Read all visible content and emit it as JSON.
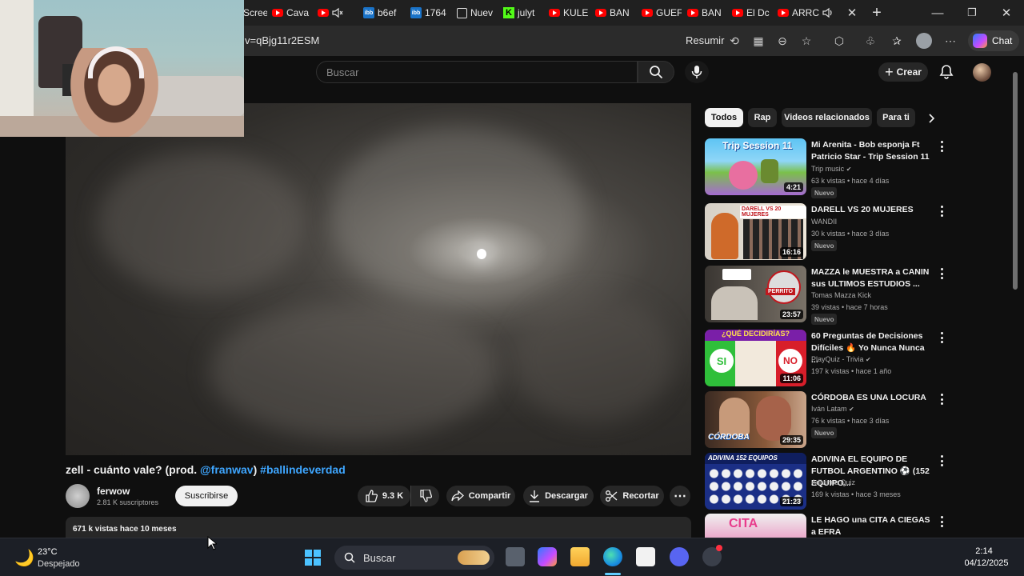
{
  "browser": {
    "tabs": [
      {
        "label": "Scree",
        "icon": "youtube-icon"
      },
      {
        "label": "Cava",
        "icon": "youtube-icon"
      },
      {
        "label": "",
        "icon": "mute-icon"
      },
      {
        "label": "b6ef",
        "icon": "ibb-icon"
      },
      {
        "label": "1764",
        "icon": "ibb-icon"
      },
      {
        "label": "Nuev",
        "icon": "calendar-icon"
      },
      {
        "label": "julyt",
        "icon": "kick-icon"
      },
      {
        "label": "KULE",
        "icon": "youtube-icon"
      },
      {
        "label": "BAN",
        "icon": "youtube-icon"
      },
      {
        "label": "GUEF",
        "icon": "youtube-icon"
      },
      {
        "label": "BAN",
        "icon": "youtube-icon"
      },
      {
        "label": "El Dc",
        "icon": "youtube-icon"
      },
      {
        "label": "ARRC",
        "icon": "youtube-icon"
      }
    ],
    "url": "v=qBjg11r2ESM",
    "summarize_label": "Resumir",
    "chat_label": "Chat"
  },
  "youtube": {
    "search_placeholder": "Buscar",
    "create_label": "Crear",
    "video": {
      "title_main": "zell - cuánto vale? (prod. ",
      "title_mention": "@franwav",
      "title_close": ") ",
      "title_hashtag": "#ballindeverdad",
      "channel": "ferwow",
      "subscribers": "2.81 K suscriptores",
      "subscribe_label": "Suscribirse",
      "likes": "9.3 K",
      "share_label": "Compartir",
      "download_label": "Descargar",
      "clip_label": "Recortar",
      "views_age": "671 k vistas  hace 10 meses"
    },
    "chips": [
      "Todos",
      "Rap",
      "Videos relacionados",
      "Para ti"
    ],
    "recommendations": [
      {
        "title": "Mi Arenita - Bob esponja Ft Patricio Star - Trip Session 11",
        "channel": "Trip music",
        "verified": true,
        "meta": "63 k vistas • hace 4 días",
        "badge": "Nuevo",
        "duration": "4:21",
        "thumb_text": "Trip Session 11"
      },
      {
        "title": "DARELL VS 20 MUJERES",
        "channel": "WANDII",
        "verified": false,
        "meta": "30 k vistas • hace 3 días",
        "badge": "Nuevo",
        "duration": "16:16",
        "thumb_text": "DARELL VS 20 MUJERES"
      },
      {
        "title": "MAZZA le MUESTRA a CANIN sus ULTIMOS ESTUDIOS ...",
        "channel": "Tomas Mazza Kick",
        "verified": false,
        "meta": "39 vistas • hace 7 horas",
        "badge": "Nuevo",
        "duration": "23:57",
        "thumb_text": "PERRITO"
      },
      {
        "title": "60 Preguntas de Decisiones Difíciles 🔥 Yo Nunca Nunca ...",
        "channel": "PlayQuiz - Trivia",
        "verified": true,
        "meta": "197 k vistas • hace 1 año",
        "badge": "",
        "duration": "11:06",
        "thumb_text": "¿QUÉ DECIDIRÍAS?"
      },
      {
        "title": "CÓRDOBA ES UNA LOCURA",
        "channel": "Iván Latam",
        "verified": true,
        "meta": "76 k vistas • hace 3 días",
        "badge": "Nuevo",
        "duration": "29:35",
        "thumb_text": "CÓRDOBA"
      },
      {
        "title": "ADIVINA EL EQUIPO DE FUTBOL ARGENTINO ⚽ (152 EQUIPO...",
        "channel": "Adivinus Quiz",
        "verified": false,
        "meta": "169 k vistas • hace 3 meses",
        "badge": "",
        "duration": "21:23",
        "thumb_text": "ADIVINA 152 EQUIPOS"
      },
      {
        "title": "LE HAGO una CITA A CIEGAS a EFRA",
        "channel": "",
        "verified": false,
        "meta": "",
        "badge": "",
        "duration": "",
        "thumb_text": "CITA"
      }
    ]
  },
  "taskbar": {
    "weather_temp": "23°C",
    "weather_desc": "Despejado",
    "search_label": "Buscar",
    "time": "2:14",
    "date": "04/12/2025"
  },
  "colors": {
    "accent_link": "#3ea6ff",
    "yt_red": "#ff0000",
    "bg": "#0f0f0f"
  }
}
